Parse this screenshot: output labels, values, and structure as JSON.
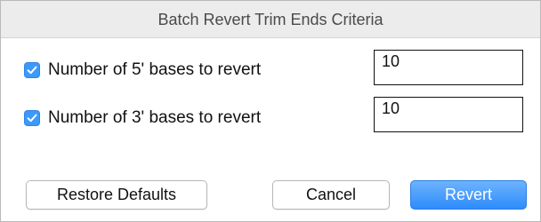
{
  "dialog": {
    "title": "Batch Revert Trim Ends Criteria"
  },
  "options": [
    {
      "checked": true,
      "label": "Number of 5' bases to revert",
      "value": "10"
    },
    {
      "checked": true,
      "label": "Number of 3' bases to revert",
      "value": "10"
    }
  ],
  "buttons": {
    "restore_defaults": "Restore Defaults",
    "cancel": "Cancel",
    "revert": "Revert"
  },
  "colors": {
    "accent": "#3b99fc",
    "titlebar": "#ececec"
  },
  "icons": {
    "checkbox": "checkmark-icon"
  }
}
